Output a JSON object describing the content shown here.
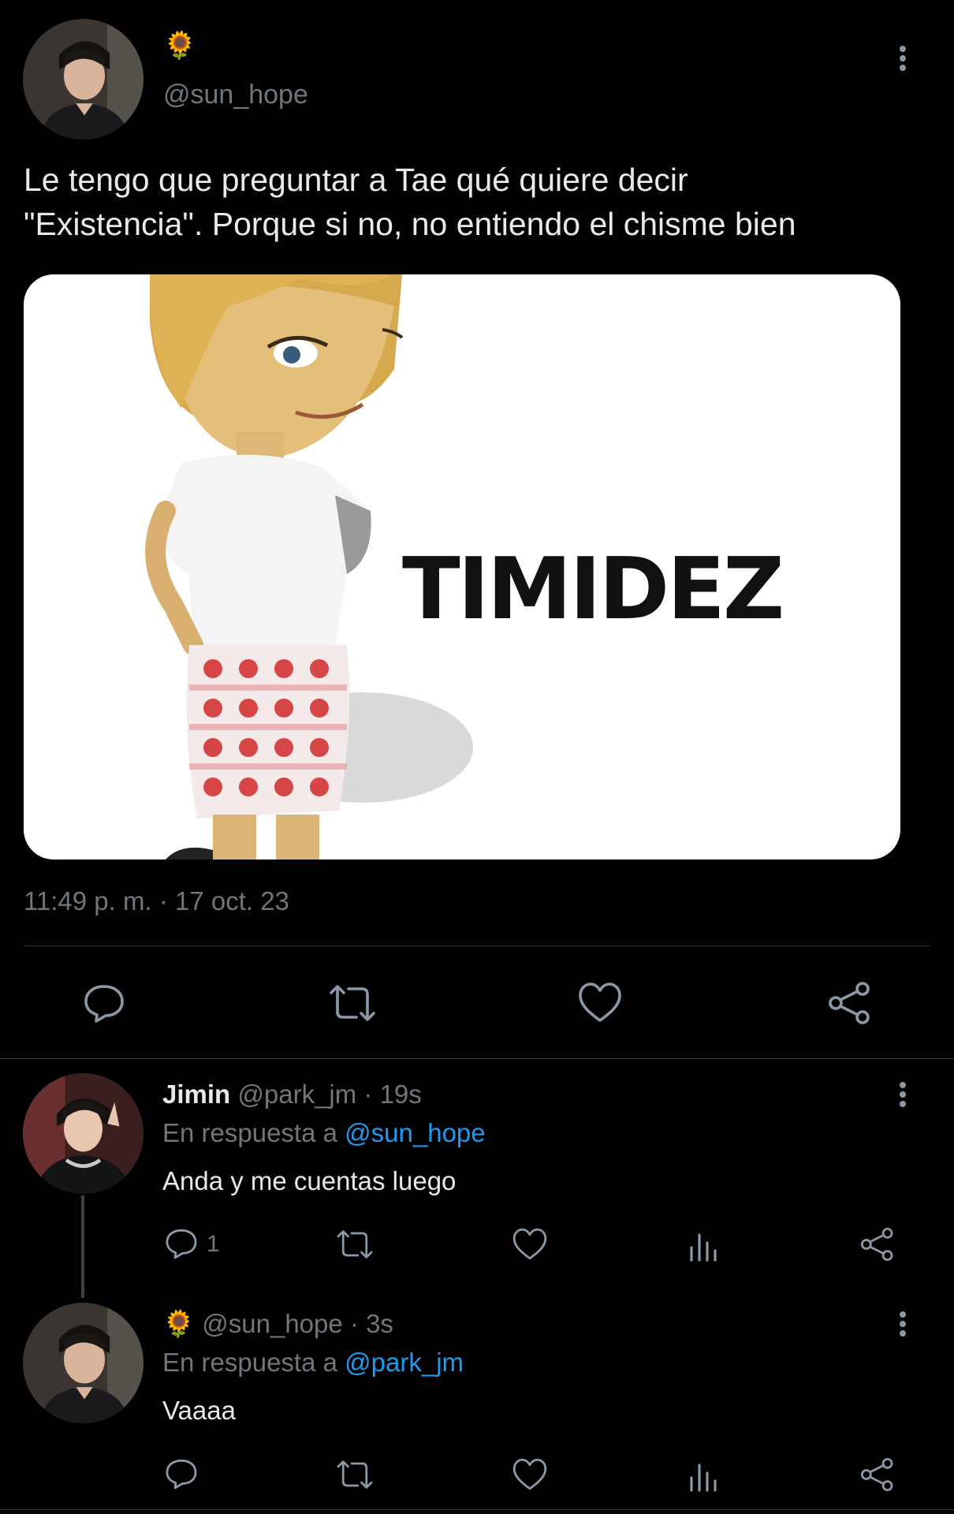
{
  "main_tweet": {
    "emoji": "🌻",
    "handle": "@sun_hope",
    "text_line1": "Le tengo que preguntar a Tae qué quiere decir",
    "text_line2": "\"Existencia\". Porque si no, no entiendo el chisme bien",
    "image_caption": "TIMIDEZ",
    "timestamp": "11:49 p. m. · 17 oct. 23"
  },
  "replies": [
    {
      "name": "Jimin",
      "handle_time": "@park_jm · 19s",
      "reply_prefix": "En respuesta a",
      "reply_to": "@sun_hope",
      "text": "Anda y me cuentas luego",
      "reply_count": "1"
    },
    {
      "emoji": "🌻",
      "handle_time": "@sun_hope · 3s",
      "reply_prefix": "En respuesta a",
      "reply_to": "@park_jm",
      "text": "Vaaaa"
    }
  ],
  "colors": {
    "background": "#000000",
    "text": "#e7e9ea",
    "muted": "#71767b",
    "link": "#1d9bf0",
    "divider": "#2f3336"
  }
}
